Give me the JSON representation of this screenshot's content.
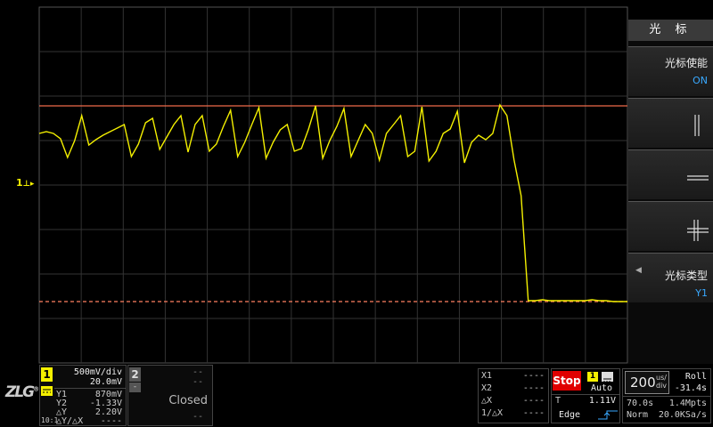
{
  "colors": {
    "ch1": "#f4f000",
    "cursor_solid": "#f06a4a",
    "cursor_dashed": "#ff8060",
    "grid": "#333333",
    "stop": "#e00000",
    "accent_blue": "#39a9ff"
  },
  "trace": {
    "points_y": [
      150,
      148,
      150,
      156,
      177,
      158,
      130,
      163,
      157,
      152,
      148,
      144,
      140,
      176,
      162,
      138,
      133,
      168,
      154,
      140,
      130,
      171,
      140,
      130,
      170,
      162,
      142,
      124,
      176,
      160,
      140,
      121,
      178,
      160,
      146,
      140,
      170,
      167,
      145,
      119,
      178,
      158,
      142,
      122,
      176,
      158,
      140,
      150,
      180,
      150,
      140,
      130,
      176,
      170,
      120,
      181,
      170,
      150,
      145,
      125,
      183,
      160,
      152,
      157,
      150,
      118,
      130,
      180,
      220,
      338,
      338,
      337,
      338,
      338,
      338,
      338,
      338,
      338,
      337,
      338,
      338,
      339,
      339,
      339
    ]
  },
  "ground_marker": {
    "label": "1"
  },
  "menu": {
    "title": "光 标",
    "keys": [
      {
        "label": "光标使能",
        "value": "ON"
      },
      {
        "label": "",
        "value": "",
        "icon": "vertical-cursors-icon"
      },
      {
        "label": "",
        "value": "",
        "icon": "horizontal-cursors-icon"
      },
      {
        "label": "",
        "value": "",
        "icon": "cross-cursors-icon"
      },
      {
        "label": "光标类型",
        "value": "Y1"
      }
    ]
  },
  "logo": {
    "text": "ZLG",
    "reg": "®"
  },
  "ch1_panel": {
    "number": "1",
    "scale": "500mV/div",
    "offset": "20.0mV",
    "y1_label": "Y1",
    "y1_value": "870mV",
    "y2_label": "Y2",
    "y2_value": "-1.33V",
    "dy_label": "△Y",
    "dy_value": "2.20V",
    "probe": "10:1",
    "ratio_label": "△Y/△X",
    "ratio_value": "----"
  },
  "ch2_panel": {
    "number": "2",
    "dash1": "--",
    "dash2": "--",
    "dash3": "--",
    "status": "Closed",
    "minus": "-"
  },
  "cursor_x": {
    "x1_label": "X1",
    "x1_value": "----",
    "x2_label": "X2",
    "x2_value": "----",
    "dx_label": "△X",
    "dx_value": "----",
    "inv_label": "1/△X",
    "inv_value": "----"
  },
  "trigger": {
    "run_state": "Stop",
    "source": "1",
    "mode": "Auto",
    "type_label": "T",
    "level": "1.11V",
    "edge": "Edge"
  },
  "timebase": {
    "scale": "200",
    "unit_top": "us/",
    "unit_bottom": "div",
    "mode": "Roll",
    "position": "-31.4s",
    "duration": "70.0s",
    "memory": "1.4Mpts",
    "acq": "Norm",
    "rate": "20.0KSa/s"
  }
}
